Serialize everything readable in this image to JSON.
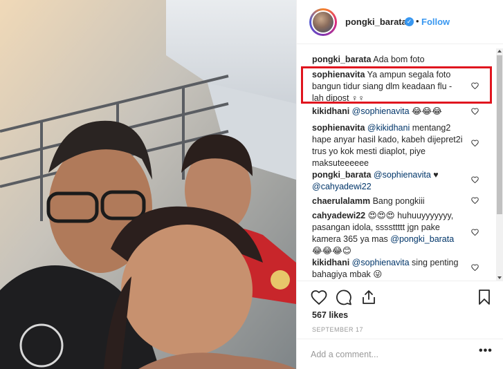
{
  "header": {
    "username": "pongki_barata",
    "separator": "•",
    "follow_label": "Follow",
    "verified_icon": "verified-check-icon"
  },
  "comments": [
    {
      "user": "pongki_barata",
      "text": "Ada bom foto"
    },
    {
      "user": "sophienavita",
      "text": "Ya ampun segala foto bangun tidur siang dlm keadaan flu - lah dipost ♀♀",
      "highlighted": true
    },
    {
      "user": "kikidhani",
      "mention": "@sophienavita",
      "text": "😂😂😂"
    },
    {
      "user": "sophienavita",
      "mention": "@kikidhani",
      "text": "mentang2 hape anyar hasil kado, kabeh dijepret2i trus yo kok mesti diaplot, piye maksuteeeeee"
    },
    {
      "user": "pongki_barata",
      "mention": "@sophienavita",
      "text": "♥",
      "mention2": "@cahyadewi22"
    },
    {
      "user": "chaerulalamm",
      "text": "Bang pongkiii"
    },
    {
      "user": "cahyadewi22",
      "text": "😍😍😍 huhuuyyyyyyy, pasangan idola, ssssttttt jgn pake kamera 365 ya mas",
      "mention": "@pongki_barata",
      "text2": "😂😂😂😊"
    },
    {
      "user": "kikidhani",
      "mention": "@sophienavita",
      "text": "sing penting bahagiya mbak 😜"
    }
  ],
  "actions": {
    "like_icon": "heart-icon",
    "comment_icon": "comment-icon",
    "share_icon": "share-icon",
    "save_icon": "bookmark-icon"
  },
  "likes": "567 likes",
  "date": "SEPTEMBER 17",
  "add_comment": {
    "placeholder": "Add a comment...",
    "more_label": "•••"
  },
  "colors": {
    "accent": "#3897f0",
    "highlight_border": "#e0141e",
    "text": "#262626",
    "mention": "#003569"
  }
}
